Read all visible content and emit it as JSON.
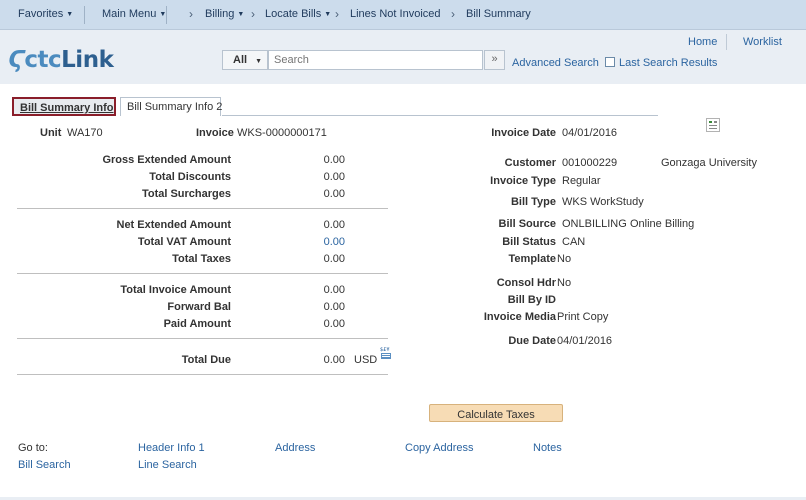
{
  "nav": {
    "favorites": "Favorites",
    "main_menu": "Main Menu",
    "crumbs": [
      "Billing",
      "Locate Bills",
      "Lines Not Invoiced",
      "Bill Summary"
    ]
  },
  "header": {
    "logo_prefix": "ctc",
    "logo_suffix": "Link",
    "home": "Home",
    "worklist": "Worklist",
    "search_scope": "All",
    "search_placeholder": "Search",
    "advanced_search": "Advanced Search",
    "last_search_results": "Last Search Results"
  },
  "tabs": [
    "Bill Summary Info",
    "Bill Summary Info 2"
  ],
  "left": {
    "unit_label": "Unit",
    "unit_value": "WA170",
    "invoice_label": "Invoice",
    "invoice_value": "WKS-0000000171",
    "amounts_group1": [
      {
        "label": "Gross Extended Amount",
        "value": "0.00"
      },
      {
        "label": "Total Discounts",
        "value": "0.00"
      },
      {
        "label": "Total Surcharges",
        "value": "0.00"
      }
    ],
    "amounts_group2": [
      {
        "label": "Net Extended Amount",
        "value": "0.00"
      },
      {
        "label": "Total VAT Amount",
        "value": "0.00"
      },
      {
        "label": "Total Taxes",
        "value": "0.00"
      }
    ],
    "amounts_group3": [
      {
        "label": "Total Invoice Amount",
        "value": "0.00"
      },
      {
        "label": "Forward Bal",
        "value": "0.00"
      },
      {
        "label": "Paid Amount",
        "value": "0.00"
      }
    ],
    "total_due_label": "Total Due",
    "total_due_value": "0.00",
    "currency": "USD"
  },
  "right": {
    "invoice_date_label": "Invoice Date",
    "invoice_date_value": "04/01/2016",
    "customer_label": "Customer",
    "customer_id": "001000229",
    "customer_name": "Gonzaga University",
    "invoice_type_label": "Invoice Type",
    "invoice_type_value": "Regular",
    "bill_type_label": "Bill Type",
    "bill_type_value": "WKS WorkStudy",
    "bill_source_label": "Bill Source",
    "bill_source_value": "ONLBILLING",
    "bill_source_desc": "Online Billing",
    "bill_status_label": "Bill Status",
    "bill_status_value": "CAN",
    "template_label": "Template",
    "template_value": "No",
    "consol_hdr_label": "Consol Hdr",
    "consol_hdr_value": "No",
    "bill_by_id_label": "Bill By ID",
    "invoice_media_label": "Invoice Media",
    "invoice_media_value": "Print Copy",
    "due_date_label": "Due Date",
    "due_date_value": "04/01/2016"
  },
  "calculate_taxes": "Calculate Taxes",
  "goto": {
    "label": "Go to:",
    "header_info": "Header Info 1",
    "address": "Address",
    "copy_address": "Copy Address",
    "notes": "Notes",
    "bill_search": "Bill Search",
    "line_search": "Line Search"
  }
}
